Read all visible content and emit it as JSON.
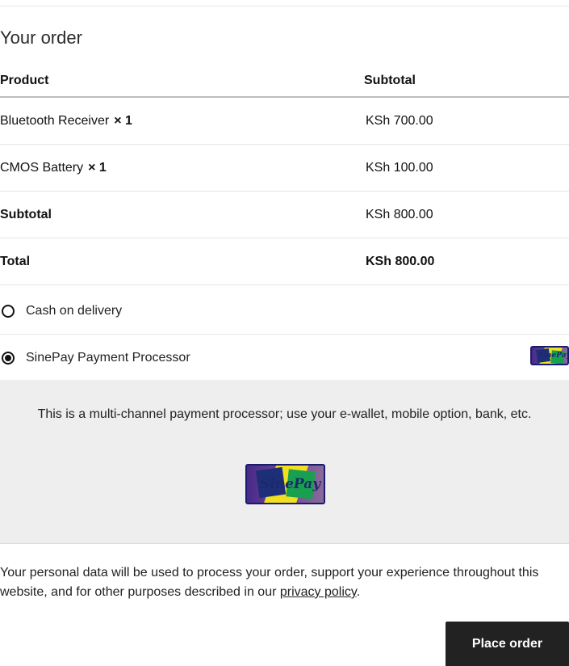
{
  "order": {
    "heading": "Your order",
    "columns": {
      "product": "Product",
      "subtotal": "Subtotal"
    },
    "items": [
      {
        "name": "Bluetooth Receiver",
        "qty": "× 1",
        "price": "KSh 700.00"
      },
      {
        "name": "CMOS Battery",
        "qty": "× 1",
        "price": "KSh 100.00"
      }
    ],
    "subtotal": {
      "label": "Subtotal",
      "value": "KSh 800.00"
    },
    "total": {
      "label": "Total",
      "value": "KSh 800.00"
    }
  },
  "payment": {
    "methods": [
      {
        "label": "Cash on delivery",
        "selected": false
      },
      {
        "label": "SinePay Payment Processor",
        "selected": true,
        "icon": "sinepay-logo"
      }
    ],
    "description": "This is a multi-channel payment processor; use your e-wallet, mobile option, bank, etc.",
    "logo_text": "SinePay"
  },
  "privacy": {
    "text": "Your personal data will be used to process your order, support your experience throughout this website, and for other purposes described in our ",
    "link": "privacy policy",
    "end": "."
  },
  "actions": {
    "place_order": "Place order"
  },
  "colors": {
    "button_bg": "#222222",
    "panel_bg": "#eeeeee",
    "divider": "#e6e6e6"
  }
}
